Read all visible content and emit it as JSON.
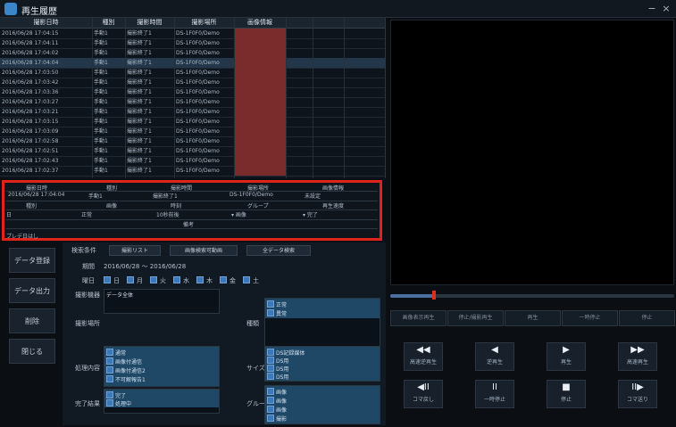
{
  "window": {
    "title": "再生履歴",
    "icon": "app-logo-icon",
    "minimize": "−",
    "close": "×"
  },
  "table": {
    "columns": [
      "撮影日時",
      "種別",
      "撮影時間",
      "撮影場所",
      "画像情報",
      "",
      "",
      ""
    ],
    "rows": [
      [
        "2016/06/28 17:04:15",
        "手動1",
        "撮影終了1",
        "DS-1F0F0/Demo",
        "",
        "",
        "",
        ""
      ],
      [
        "2016/06/28 17:04:11",
        "手動1",
        "撮影終了1",
        "DS-1F0F0/Demo",
        "",
        "",
        "",
        ""
      ],
      [
        "2016/06/28 17:04:02",
        "手動1",
        "撮影終了1",
        "DS-1F0F0/Demo",
        "",
        "",
        "",
        ""
      ],
      [
        "2016/06/28 17:04:04",
        "手動1",
        "撮影終了1",
        "DS-1F0F0/Demo",
        "",
        "",
        "",
        ""
      ],
      [
        "2016/06/28 17:03:50",
        "手動1",
        "撮影終了1",
        "DS-1F0F0/Demo",
        "",
        "",
        "",
        ""
      ],
      [
        "2016/06/28 17:03:42",
        "手動1",
        "撮影終了1",
        "DS-1F0F0/Demo",
        "",
        "",
        "",
        ""
      ],
      [
        "2016/06/28 17:03:36",
        "手動1",
        "撮影終了1",
        "DS-1F0F0/Demo",
        "",
        "",
        "",
        ""
      ],
      [
        "2016/06/28 17:03:27",
        "手動1",
        "撮影終了1",
        "DS-1F0F0/Demo",
        "",
        "",
        "",
        ""
      ],
      [
        "2016/06/28 17:03:21",
        "手動1",
        "撮影終了1",
        "DS-1F0F0/Demo",
        "",
        "",
        "",
        ""
      ],
      [
        "2016/06/28 17:03:15",
        "手動1",
        "撮影終了1",
        "DS-1F0F0/Demo",
        "",
        "",
        "",
        ""
      ],
      [
        "2016/06/28 17:03:09",
        "手動1",
        "撮影終了1",
        "DS-1F0F0/Demo",
        "",
        "",
        "",
        ""
      ],
      [
        "2016/06/28 17:02:58",
        "手動1",
        "撮影終了1",
        "DS-1F0F0/Demo",
        "",
        "",
        "",
        ""
      ],
      [
        "2016/06/28 17:02:51",
        "手動1",
        "撮影終了1",
        "DS-1F0F0/Demo",
        "",
        "",
        "",
        ""
      ],
      [
        "2016/06/28 17:02:43",
        "手動1",
        "撮影終了1",
        "DS-1F0F0/Demo",
        "",
        "",
        "",
        ""
      ],
      [
        "2016/06/28 17:02:37",
        "手動1",
        "撮影終了1",
        "DS-1F0F0/Demo",
        "",
        "",
        "",
        ""
      ]
    ]
  },
  "detail": {
    "row1_labels": [
      "撮影日時",
      "種別",
      "撮影時間",
      "撮影場所",
      "画像情報"
    ],
    "row1_values": [
      "2016/06/28 17:04:04",
      "手動1",
      "撮影終了1",
      "DS-1F0F0/Demo",
      "未設定"
    ],
    "row2_labels": [
      "種別",
      "画像",
      "時刻",
      "グループ",
      "再生速度"
    ],
    "row3_values": [
      "日",
      "正常",
      "10秒前後",
      "▾ 画像",
      "▾ 完了"
    ],
    "memo_label": "備考",
    "footer": "プレデ日はし"
  },
  "nav": [
    "データ登録",
    "データ出力",
    "削除",
    "閉じる"
  ],
  "search": {
    "tabs": [
      "検索条件",
      "撮影リスト",
      "画像検索可動画",
      "全データ検索"
    ],
    "period_label": "期間",
    "period_value": "2016/06/28  〜  2016/06/28",
    "day_label": "曜日",
    "days": [
      "日",
      "月",
      "火",
      "水",
      "木",
      "金",
      "土"
    ],
    "cam_label": "撮影機器",
    "cam_placeholder": "データ全体",
    "place_label": "撮影場所",
    "kind_label": "種類",
    "kind_items": [
      "正常",
      "異常"
    ],
    "status_label": "処理内容",
    "status_items": [
      "通常",
      "画像付通信",
      "画像付通信2",
      "不可解報告1"
    ],
    "result_label": "完了結果",
    "result_items": [
      "完了",
      "処理中"
    ],
    "group_label": "サイズ",
    "group_items": [
      "DS記録媒体",
      "DS用",
      "DS用",
      "DS用"
    ],
    "group2_label": "グループ",
    "group2_items": [
      "画像",
      "画像",
      "画像",
      "撮影"
    ]
  },
  "player": {
    "top_buttons": [
      "画像表示再生",
      "停止/撮影再生",
      "再生",
      "一時停止",
      "停止"
    ],
    "controls": [
      {
        "icon": "◀◀",
        "label": "高速逆再生"
      },
      {
        "icon": "◀",
        "label": "逆再生"
      },
      {
        "icon": "▶",
        "label": "再生"
      },
      {
        "icon": "▶▶",
        "label": "高速再生"
      },
      {
        "icon": "◀II",
        "label": "コマ戻し"
      },
      {
        "icon": "II",
        "label": "一時停止"
      },
      {
        "icon": "■",
        "label": "停止"
      },
      {
        "icon": "II▶",
        "label": "コマ送り"
      }
    ],
    "seek_progress": 0.15
  }
}
